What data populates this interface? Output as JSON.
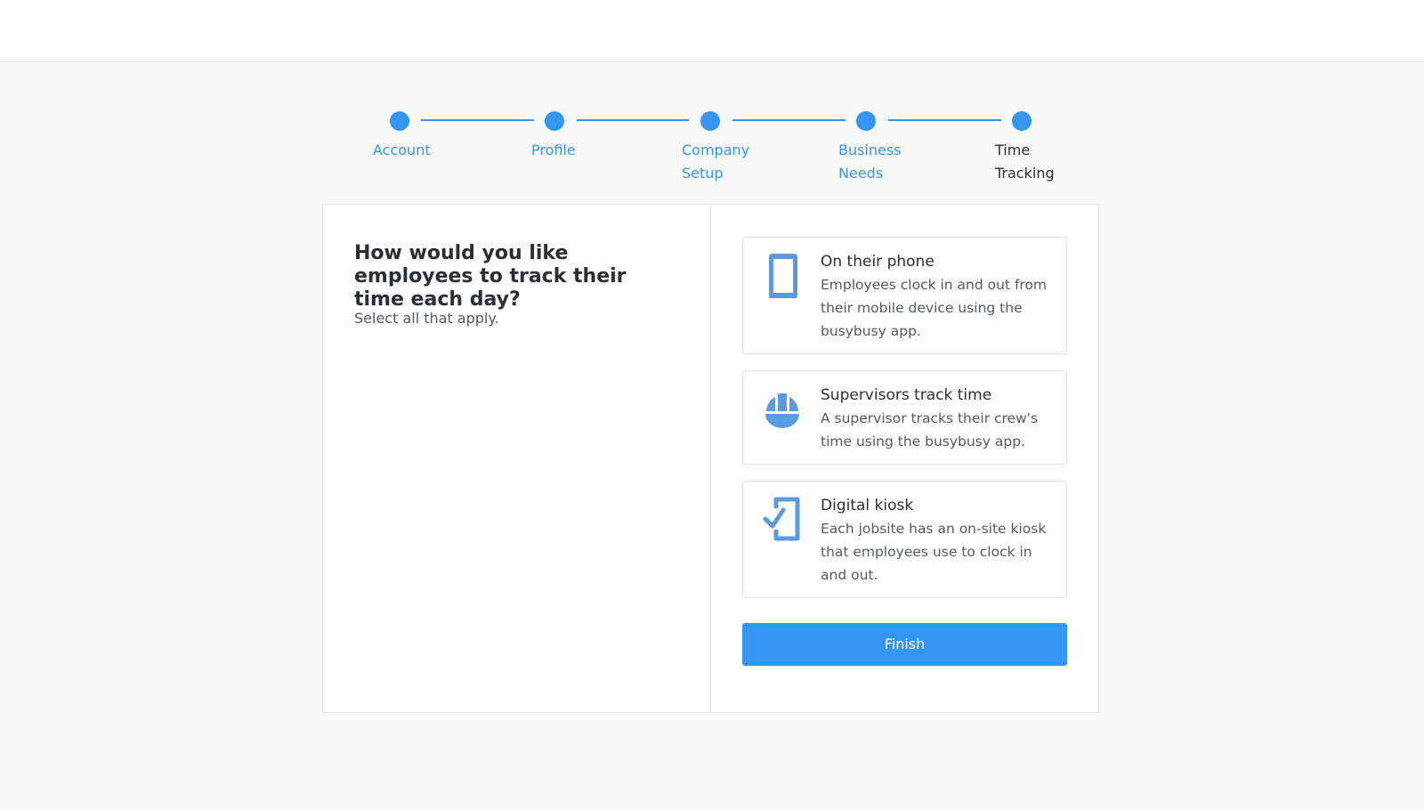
{
  "stepper": {
    "steps": [
      {
        "label": "Account"
      },
      {
        "label": "Profile"
      },
      {
        "label": "Company\nSetup"
      },
      {
        "label": "Business\nNeeds"
      },
      {
        "label": "Time\nTracking"
      }
    ],
    "current_step": 5
  },
  "left_panel": {
    "question": "How would you like employees to track their time each day?",
    "hint": "Select all that apply."
  },
  "options": [
    {
      "icon": "phone-icon",
      "title": "On their phone",
      "description": "Employees clock in and out from their mobile device using the busybusy app."
    },
    {
      "icon": "hard-hat-icon",
      "title": "Supervisors track time",
      "description": "A supervisor tracks their crew's time using the busybusy app."
    },
    {
      "icon": "kiosk-check-icon",
      "title": "Digital kiosk",
      "description": "Each jobsite has an on-site kiosk that employees use to clock in and out."
    }
  ],
  "actions": {
    "finish_label": "Finish"
  },
  "colors": {
    "accent": "#3595f2",
    "icon": "#5a9be0",
    "page_background": "#f9f9f9"
  }
}
